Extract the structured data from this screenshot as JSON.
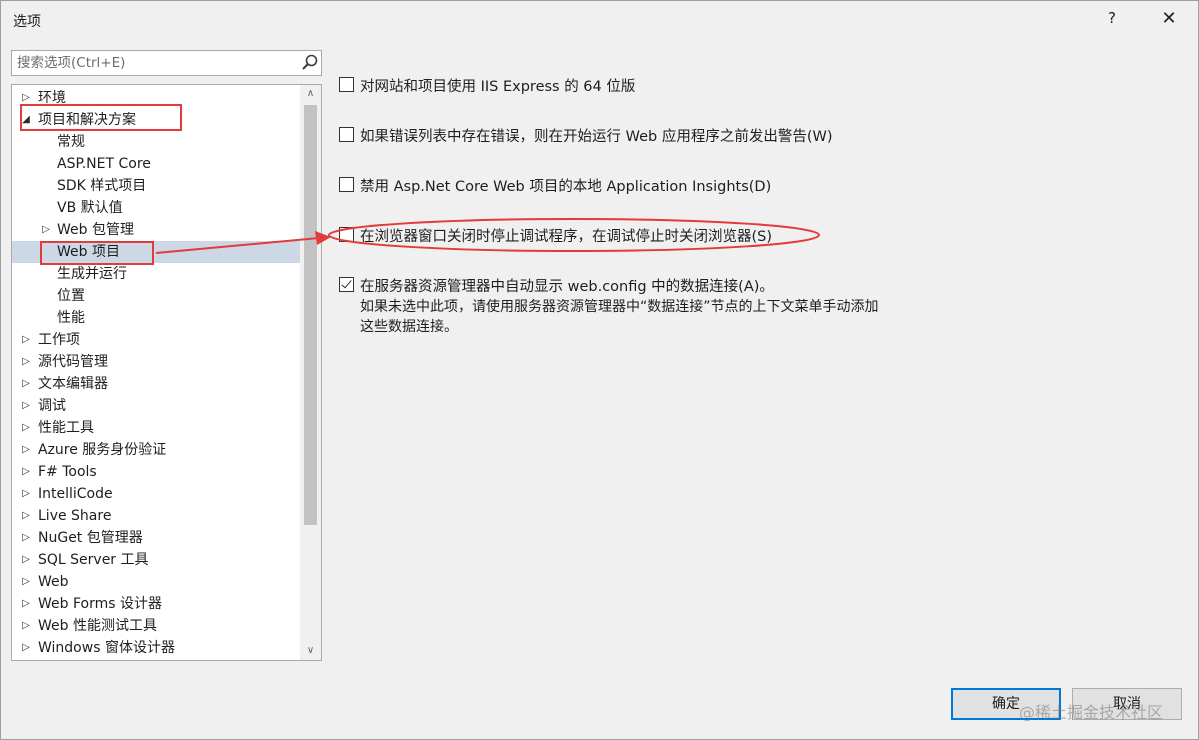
{
  "window": {
    "title": "选项",
    "help": "?",
    "close": "✕"
  },
  "search": {
    "placeholder": "搜索选项(Ctrl+E)"
  },
  "tree": {
    "items": [
      {
        "label": "环境",
        "arrow": "▷"
      },
      {
        "label": "项目和解决方案",
        "arrow": "◢"
      },
      {
        "label": "常规",
        "arrow": ""
      },
      {
        "label": "ASP.NET Core",
        "arrow": ""
      },
      {
        "label": "SDK 样式项目",
        "arrow": ""
      },
      {
        "label": "VB 默认值",
        "arrow": ""
      },
      {
        "label": "Web 包管理",
        "arrow": "▷"
      },
      {
        "label": "Web 项目",
        "arrow": ""
      },
      {
        "label": "生成并运行",
        "arrow": ""
      },
      {
        "label": "位置",
        "arrow": ""
      },
      {
        "label": "性能",
        "arrow": ""
      },
      {
        "label": "工作项",
        "arrow": "▷"
      },
      {
        "label": "源代码管理",
        "arrow": "▷"
      },
      {
        "label": "文本编辑器",
        "arrow": "▷"
      },
      {
        "label": "调试",
        "arrow": "▷"
      },
      {
        "label": "性能工具",
        "arrow": "▷"
      },
      {
        "label": "Azure 服务身份验证",
        "arrow": "▷"
      },
      {
        "label": "F# Tools",
        "arrow": "▷"
      },
      {
        "label": "IntelliCode",
        "arrow": "▷"
      },
      {
        "label": "Live Share",
        "arrow": "▷"
      },
      {
        "label": "NuGet 包管理器",
        "arrow": "▷"
      },
      {
        "label": "SQL Server 工具",
        "arrow": "▷"
      },
      {
        "label": "Web",
        "arrow": "▷"
      },
      {
        "label": "Web Forms 设计器",
        "arrow": "▷"
      },
      {
        "label": "Web 性能测试工具",
        "arrow": "▷"
      },
      {
        "label": "Windows 窗体设计器",
        "arrow": "▷"
      }
    ],
    "scroll_up": "∧",
    "scroll_down": "∨"
  },
  "options": [
    {
      "label": "对网站和项目使用 IIS Express 的 64 位版",
      "checked": false
    },
    {
      "label": "如果错误列表中存在错误，则在开始运行 Web 应用程序之前发出警告(W)",
      "checked": false
    },
    {
      "label": "禁用 Asp.Net Core Web 项目的本地 Application Insights(D)",
      "checked": false
    },
    {
      "label": "在浏览器窗口关闭时停止调试程序，在调试停止时关闭浏览器(S)",
      "checked": false
    },
    {
      "label": "在服务器资源管理器中自动显示 web.config 中的数据连接(A)。",
      "checked": true,
      "description_line1": "如果未选中此项，请使用服务器资源管理器中“数据连接”节点的上下文菜单手动添加",
      "description_line2": "这些数据连接。"
    }
  ],
  "buttons": {
    "ok": "确定",
    "cancel": "取消"
  },
  "watermark": "@稀土掘金技术社区",
  "annotation_color": "#e23b3b"
}
